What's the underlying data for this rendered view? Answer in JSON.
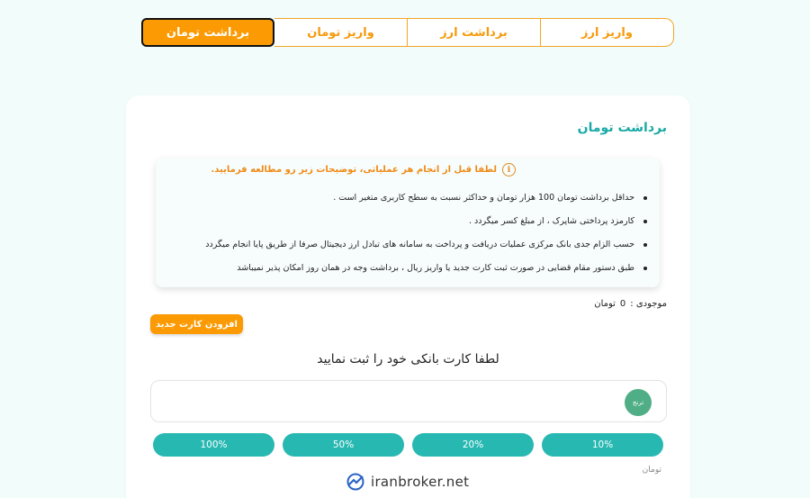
{
  "tabs": [
    {
      "label": "واریز ارز",
      "active": false
    },
    {
      "label": "برداشت ارز",
      "active": false
    },
    {
      "label": "واریز تومان",
      "active": false
    },
    {
      "label": "برداشت تومان",
      "active": true
    }
  ],
  "card": {
    "title": "برداشت تومان",
    "notice_heading": "لطفا قبل از انجام هر عملیاتی، توضیحات زیر رو مطالعه فرمایید.",
    "notice_items": [
      "حداقل برداشت تومان 100 هزار تومان و حداکثر نسبت به سطح کاربری متغیر است .",
      "کارمزد پرداختی شاپرک ، از مبلغ کسر میگردد .",
      "حسب الزام جدی بانک مرکزی عملیات دریافت و پرداخت به سامانه های تبادل ارز دیجیتال صرفا از طریق پایا انجام میگردد",
      "طبق دستور مقام قضایی در صورت ثبت کارت جدید یا واریز ریال ، برداشت وجه در همان روز امکان پذیر نمیباشد"
    ],
    "balance_label": "موجودی :",
    "balance_value": "0",
    "balance_unit": "تومان",
    "add_card_label": "افزودن کارت جدید",
    "prompt": "لطفا کارت بانکی خود را ثبت نمایید",
    "card_badge": "ترنج",
    "percent_options": [
      "10%",
      "20%",
      "50%",
      "100%"
    ],
    "unit_label": "تومان"
  },
  "watermark": "iranbroker.net",
  "colors": {
    "accent": "#fb9a03",
    "teal": "#28b8b2",
    "title": "#1aa9a6"
  }
}
